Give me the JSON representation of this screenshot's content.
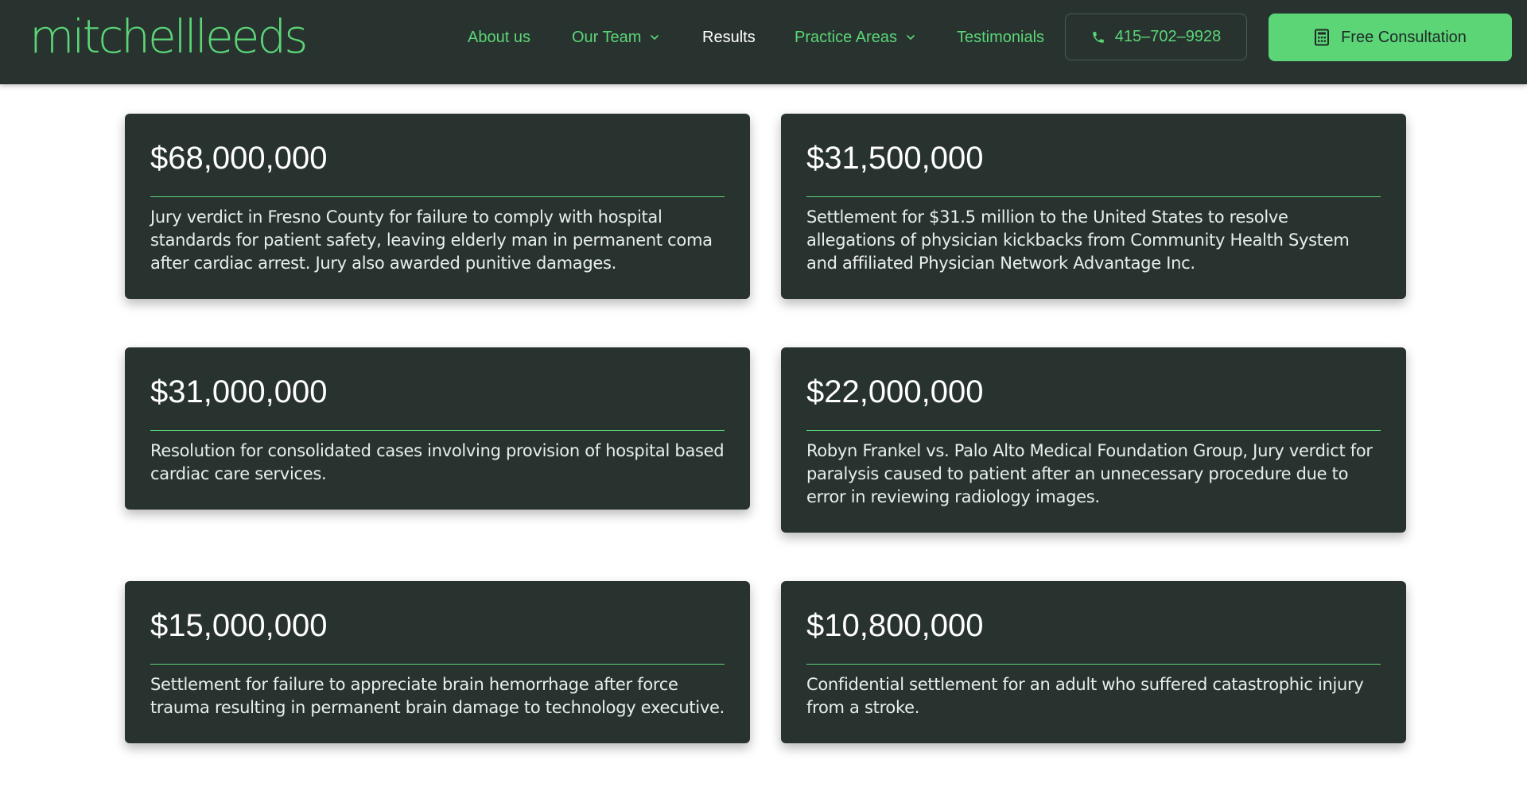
{
  "brand": {
    "logo_text": "mitchellleeds",
    "accent_color": "#5cd577",
    "header_bg": "#283330"
  },
  "nav": {
    "items": [
      {
        "label": "About us",
        "has_dropdown": false,
        "active": false
      },
      {
        "label": "Our Team",
        "has_dropdown": true,
        "active": false
      },
      {
        "label": "Results",
        "has_dropdown": false,
        "active": true
      },
      {
        "label": "Practice Areas",
        "has_dropdown": true,
        "active": false
      },
      {
        "label": "Testimonials",
        "has_dropdown": false,
        "active": false
      }
    ],
    "phone": {
      "label": "415–702–9928",
      "icon": "phone-icon"
    },
    "cta": {
      "label": "Free Consultation",
      "icon": "calculator-icon"
    }
  },
  "results": [
    {
      "amount": "$68,000,000",
      "description": "Jury verdict in Fresno County for failure to comply with hospital standards for patient safety, leaving elderly man in permanent coma after cardiac arrest. Jury also awarded punitive damages."
    },
    {
      "amount": "$31,500,000",
      "description": "Settlement for $31.5 million to the United States to resolve allegations of physician kickbacks from Community Health System and affiliated Physician Network Advantage Inc."
    },
    {
      "amount": "$31,000,000",
      "description": "Resolution for consolidated cases involving provision of hospital based cardiac care services."
    },
    {
      "amount": "$22,000,000",
      "description": "Robyn Frankel vs. Palo Alto Medical Foundation Group, Jury verdict for paralysis caused to patient after an unnecessary procedure due to error in reviewing radiology images."
    },
    {
      "amount": "$15,000,000",
      "description": "Settlement for failure to appreciate brain hemorrhage after force trauma resulting in permanent brain damage to technology executive."
    },
    {
      "amount": "$10,800,000",
      "description": "Confidential settlement for an adult who suffered catastrophic injury from a stroke."
    }
  ]
}
